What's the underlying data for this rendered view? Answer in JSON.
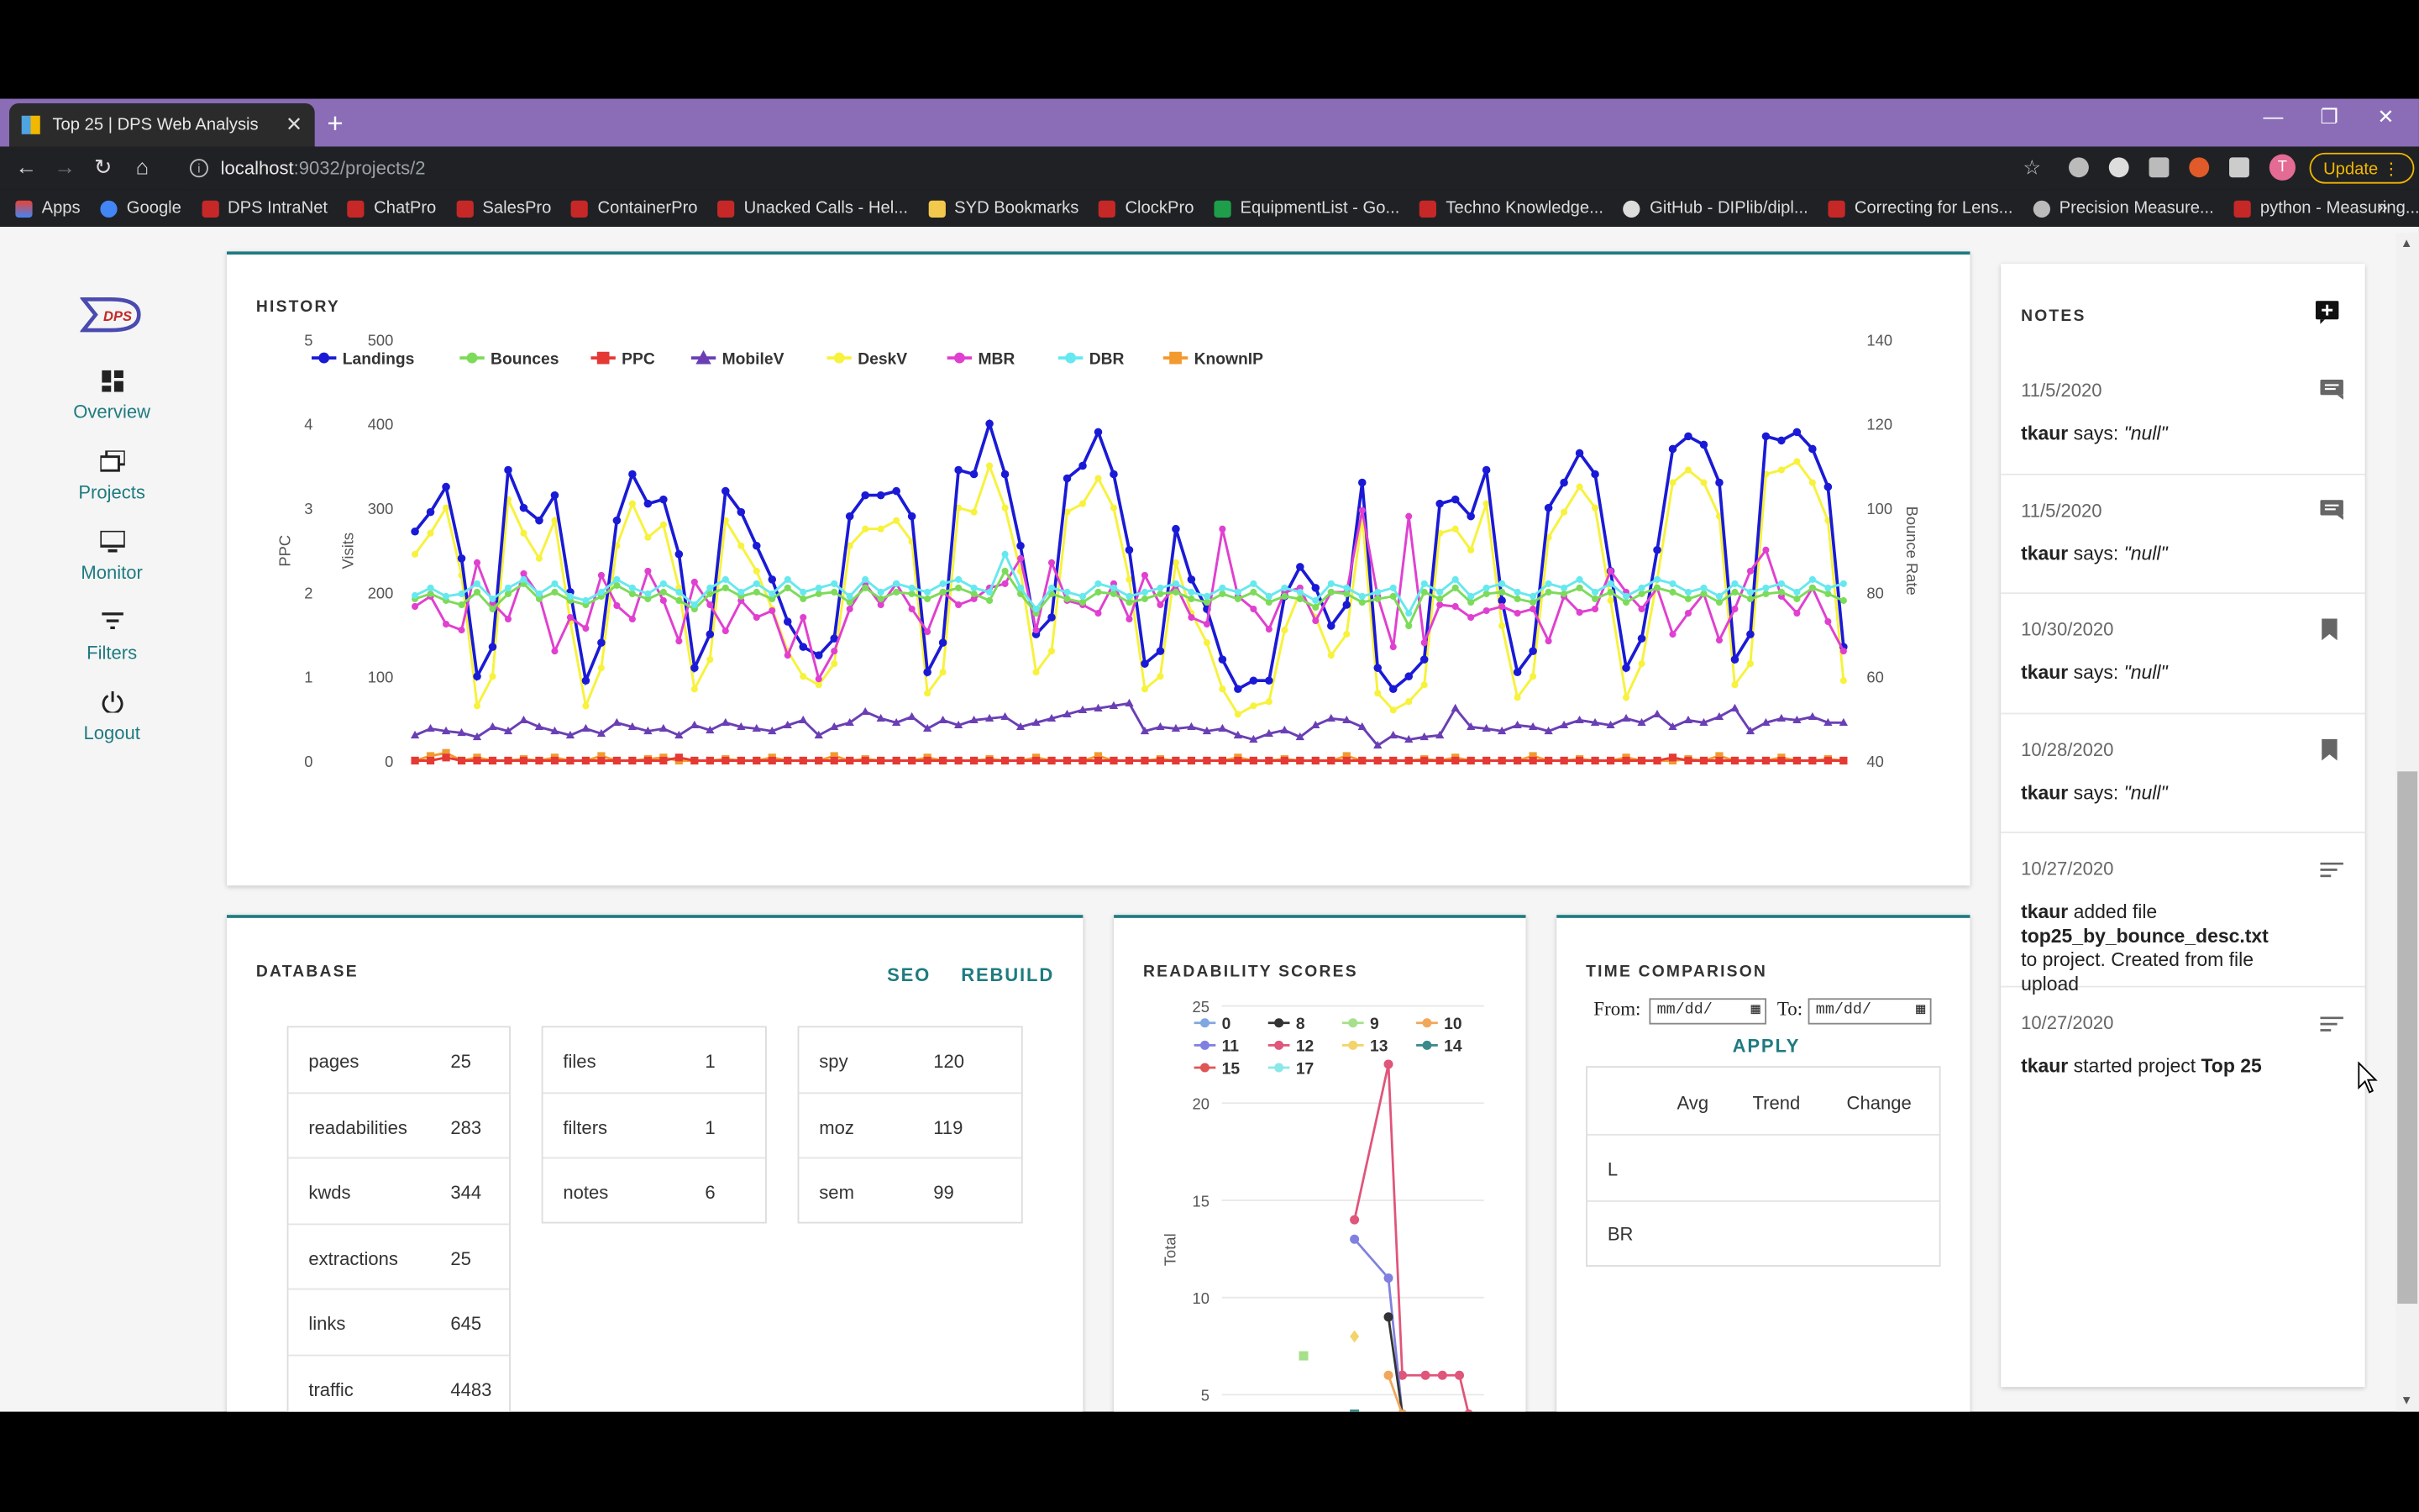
{
  "browser": {
    "tab_title": "Top 25 | DPS Web Analysis",
    "url_host": "localhost",
    "url_path": ":9032/projects/2",
    "update_label": "Update",
    "avatar_letter": "T",
    "bookmarks": [
      "Apps",
      "Google",
      "DPS IntraNet",
      "ChatPro",
      "SalesPro",
      "ContainerPro",
      "Unacked Calls - Hel...",
      "SYD Bookmarks",
      "ClockPro",
      "EquipmentList - Go...",
      "Techno Knowledge...",
      "GitHub - DIPlib/dipl...",
      "Correcting for Lens...",
      "Precision Measure...",
      "python - Measuring..."
    ],
    "bookmarks_more": "»"
  },
  "sidebar": {
    "logo": "DPS",
    "items": [
      {
        "label": "Overview",
        "icon": "dashboard-icon"
      },
      {
        "label": "Projects",
        "icon": "projects-icon"
      },
      {
        "label": "Monitor",
        "icon": "monitor-icon"
      },
      {
        "label": "Filters",
        "icon": "filter-icon"
      },
      {
        "label": "Logout",
        "icon": "power-icon"
      }
    ]
  },
  "history": {
    "title": "HISTORY"
  },
  "chart_data": {
    "type": "line",
    "title": "HISTORY",
    "legend": [
      "Landings",
      "Bounces",
      "PPC",
      "MobileV",
      "DeskV",
      "MBR",
      "DBR",
      "KnownIP"
    ],
    "colors": {
      "Landings": "#1a1ad6",
      "Bounces": "#7ddb5a",
      "PPC": "#e53935",
      "MobileV": "#6a3fb5",
      "DeskV": "#f7f23c",
      "MBR": "#e040d0",
      "DBR": "#66e8ef",
      "KnownIP": "#f29a2e"
    },
    "y_left1": {
      "label": "PPC",
      "ticks": [
        "0",
        "1",
        "2",
        "3",
        "4",
        "5"
      ]
    },
    "y_left2": {
      "label": "Visits",
      "ticks": [
        "0",
        "100",
        "200",
        "300",
        "400",
        "500"
      ],
      "range": [
        0,
        500
      ]
    },
    "y_right": {
      "label": "Bounce Rate",
      "ticks": [
        "40",
        "60",
        "80",
        "100",
        "120",
        "140"
      ],
      "range": [
        40,
        140
      ]
    },
    "series": [
      {
        "name": "Landings",
        "values": [
          272,
          295,
          325,
          240,
          100,
          135,
          345,
          300,
          285,
          315,
          200,
          95,
          140,
          285,
          340,
          305,
          310,
          245,
          110,
          150,
          320,
          295,
          255,
          215,
          165,
          135,
          125,
          145,
          290,
          315,
          315,
          320,
          290,
          105,
          140,
          345,
          340,
          400,
          340,
          255,
          150,
          170,
          335,
          350,
          390,
          340,
          250,
          115,
          130,
          275,
          215,
          180,
          120,
          85,
          95,
          95,
          195,
          230,
          205,
          160,
          185,
          330,
          110,
          85,
          100,
          120,
          305,
          310,
          290,
          345,
          190,
          105,
          130,
          300,
          330,
          365,
          340,
          225,
          110,
          145,
          250,
          370,
          385,
          375,
          330,
          120,
          150,
          385,
          380,
          390,
          370,
          325,
          135
        ]
      },
      {
        "name": "DeskV",
        "values": [
          245,
          270,
          300,
          220,
          65,
          100,
          310,
          270,
          240,
          285,
          165,
          65,
          110,
          255,
          305,
          265,
          280,
          205,
          85,
          120,
          285,
          255,
          225,
          180,
          130,
          100,
          90,
          115,
          255,
          275,
          275,
          285,
          260,
          80,
          105,
          300,
          295,
          350,
          300,
          225,
          105,
          130,
          295,
          305,
          335,
          300,
          215,
          85,
          100,
          235,
          175,
          140,
          85,
          55,
          65,
          70,
          155,
          200,
          170,
          125,
          150,
          290,
          80,
          60,
          70,
          90,
          270,
          275,
          250,
          305,
          160,
          75,
          100,
          265,
          295,
          325,
          300,
          190,
          75,
          115,
          215,
          330,
          345,
          330,
          290,
          90,
          115,
          340,
          345,
          355,
          330,
          285,
          95
        ]
      },
      {
        "name": "MBR",
        "values": [
          183,
          195,
          162,
          155,
          235,
          187,
          168,
          222,
          196,
          130,
          170,
          157,
          220,
          184,
          168,
          225,
          190,
          142,
          212,
          185,
          154,
          190,
          170,
          178,
          125,
          170,
          97,
          130,
          180,
          210,
          185,
          210,
          180,
          153,
          200,
          185,
          192,
          205,
          210,
          240,
          155,
          235,
          190,
          185,
          175,
          210,
          168,
          220,
          185,
          208,
          170,
          162,
          275,
          195,
          180,
          156,
          200,
          205,
          166,
          200,
          200,
          297,
          195,
          135,
          290,
          140,
          185,
          183,
          170,
          178,
          183,
          175,
          180,
          142,
          195,
          176,
          180,
          225,
          200,
          180,
          205,
          150,
          175,
          198,
          143,
          180,
          225,
          250,
          195,
          175,
          205,
          165,
          130
        ]
      },
      {
        "name": "DBR",
        "values": [
          196,
          205,
          195,
          198,
          210,
          192,
          205,
          215,
          198,
          210,
          195,
          190,
          200,
          215,
          205,
          198,
          210,
          200,
          185,
          205,
          215,
          200,
          210,
          198,
          215,
          200,
          205,
          210,
          195,
          215,
          200,
          210,
          205,
          200,
          210,
          215,
          205,
          200,
          245,
          205,
          180,
          205,
          200,
          195,
          210,
          205,
          195,
          200,
          205,
          210,
          200,
          195,
          205,
          200,
          210,
          195,
          205,
          200,
          190,
          210,
          205,
          195,
          200,
          205,
          175,
          210,
          200,
          215,
          195,
          205,
          210,
          200,
          195,
          210,
          205,
          215,
          200,
          210,
          195,
          205,
          215,
          210,
          200,
          205,
          195,
          210,
          200,
          205,
          210,
          200,
          215,
          205,
          210
        ]
      },
      {
        "name": "Bounces",
        "values": [
          192,
          198,
          190,
          185,
          200,
          180,
          198,
          210,
          192,
          200,
          190,
          185,
          195,
          208,
          198,
          192,
          200,
          190,
          180,
          198,
          205,
          195,
          200,
          192,
          205,
          192,
          198,
          200,
          188,
          205,
          192,
          200,
          198,
          192,
          200,
          205,
          198,
          190,
          225,
          198,
          175,
          198,
          192,
          188,
          200,
          198,
          188,
          192,
          198,
          200,
          192,
          188,
          198,
          192,
          200,
          188,
          195,
          192,
          182,
          200,
          198,
          188,
          192,
          195,
          160,
          200,
          192,
          205,
          188,
          198,
          200,
          192,
          188,
          200,
          198,
          205,
          192,
          200,
          188,
          198,
          205,
          200,
          192,
          198,
          188,
          200,
          192,
          198,
          200,
          192,
          205,
          198,
          190
        ]
      },
      {
        "name": "MobileV",
        "values": [
          30,
          38,
          35,
          33,
          28,
          40,
          35,
          48,
          40,
          35,
          30,
          38,
          32,
          45,
          40,
          35,
          38,
          30,
          42,
          36,
          45,
          40,
          38,
          35,
          42,
          48,
          30,
          40,
          45,
          58,
          50,
          45,
          52,
          38,
          48,
          42,
          48,
          50,
          52,
          40,
          45,
          50,
          55,
          60,
          62,
          65,
          68,
          35,
          40,
          38,
          40,
          35,
          38,
          30,
          25,
          32,
          36,
          28,
          42,
          50,
          48,
          40,
          18,
          30,
          25,
          28,
          30,
          62,
          40,
          38,
          35,
          42,
          40,
          35,
          42,
          48,
          45,
          42,
          50,
          45,
          55,
          40,
          48,
          45,
          52,
          62,
          35,
          45,
          50,
          48,
          52,
          45,
          45
        ]
      },
      {
        "name": "KnownIP",
        "values": [
          0,
          3,
          5,
          0,
          2,
          0,
          0,
          1,
          0,
          2,
          0,
          0,
          3,
          0,
          0,
          1,
          2,
          0,
          0,
          0,
          1,
          0,
          0,
          2,
          0,
          0,
          0,
          3,
          0,
          1,
          0,
          0,
          0,
          2,
          0,
          0,
          0,
          1,
          0,
          0,
          2,
          0,
          0,
          0,
          3,
          0,
          0,
          0,
          1,
          0,
          0,
          0,
          0,
          2,
          0,
          0,
          1,
          0,
          0,
          0,
          3,
          0,
          0,
          0,
          0,
          1,
          0,
          2,
          0,
          0,
          0,
          0,
          3,
          0,
          0,
          1,
          0,
          0,
          2,
          0,
          0,
          0,
          1,
          0,
          3,
          0,
          0,
          0,
          2,
          0,
          0,
          1,
          0
        ]
      },
      {
        "name": "PPC",
        "values": [
          0,
          0,
          2,
          0,
          0,
          0,
          0,
          0,
          0,
          0,
          0,
          0,
          0,
          0,
          0,
          0,
          0,
          2,
          0,
          0,
          0,
          0,
          0,
          0,
          0,
          0,
          0,
          0,
          0,
          0,
          0,
          0,
          0,
          0,
          0,
          0,
          0,
          0,
          0,
          0,
          0,
          0,
          0,
          0,
          0,
          0,
          0,
          0,
          0,
          0,
          0,
          0,
          0,
          0,
          0,
          0,
          0,
          0,
          0,
          0,
          0,
          0,
          0,
          0,
          0,
          0,
          0,
          0,
          0,
          0,
          0,
          0,
          0,
          0,
          0,
          0,
          0,
          0,
          0,
          0,
          0,
          2,
          0,
          0,
          0,
          0,
          0,
          0,
          0,
          0,
          0,
          0,
          0
        ]
      }
    ]
  },
  "database": {
    "title": "DATABASE",
    "seo": "SEO",
    "rebuild": "REBUILD",
    "col1": [
      {
        "k": "pages",
        "v": "25"
      },
      {
        "k": "readabilities",
        "v": "283"
      },
      {
        "k": "kwds",
        "v": "344"
      },
      {
        "k": "extractions",
        "v": "25"
      },
      {
        "k": "links",
        "v": "645"
      },
      {
        "k": "traffic",
        "v": "4483"
      }
    ],
    "col2": [
      {
        "k": "files",
        "v": "1"
      },
      {
        "k": "filters",
        "v": "1"
      },
      {
        "k": "notes",
        "v": "6"
      }
    ],
    "col3": [
      {
        "k": "spy",
        "v": "120"
      },
      {
        "k": "moz",
        "v": "119"
      },
      {
        "k": "sem",
        "v": "99"
      }
    ]
  },
  "readability": {
    "title": "READABILITY SCORES",
    "ylabel": "Total",
    "ticks": [
      "5",
      "10",
      "15",
      "20",
      "25"
    ],
    "legend": [
      {
        "n": "0",
        "c": "#7fa7e0"
      },
      {
        "n": "8",
        "c": "#333333"
      },
      {
        "n": "9",
        "c": "#a6e08a"
      },
      {
        "n": "10",
        "c": "#f2a65a"
      },
      {
        "n": "11",
        "c": "#8080e0"
      },
      {
        "n": "12",
        "c": "#e0557a"
      },
      {
        "n": "13",
        "c": "#f2d46a"
      },
      {
        "n": "14",
        "c": "#3a8a8a"
      },
      {
        "n": "15",
        "c": "#e05555"
      },
      {
        "n": "17",
        "c": "#8ae8e8"
      }
    ]
  },
  "timecomp": {
    "title": "TIME COMPARISON",
    "from": "From:",
    "to": "To:",
    "date_placeholder": "mm/dd/",
    "apply": "APPLY",
    "headers": [
      "Avg",
      "Trend",
      "Change"
    ],
    "rows": [
      "L",
      "BR"
    ]
  },
  "notes": {
    "title": "NOTES",
    "items": [
      {
        "date": "11/5/2020",
        "icon": "comment-icon",
        "user": "tkaur",
        "text": " says: ",
        "quote": "\"null\""
      },
      {
        "date": "11/5/2020",
        "icon": "comment-icon",
        "user": "tkaur",
        "text": " says: ",
        "quote": "\"null\""
      },
      {
        "date": "10/30/2020",
        "icon": "bookmark-icon",
        "user": "tkaur",
        "text": " says: ",
        "quote": "\"null\""
      },
      {
        "date": "10/28/2020",
        "icon": "bookmark-icon",
        "user": "tkaur",
        "text": " says: ",
        "quote": "\"null\""
      },
      {
        "date": "10/27/2020",
        "icon": "notes-icon",
        "user": "tkaur",
        "text": " added file ",
        "file": "top25_by_bounce_desc.txt",
        "text2": " to project. Created from file upload"
      },
      {
        "date": "10/27/2020",
        "icon": "notes-icon",
        "user": "tkaur",
        "text": " started project ",
        "file": "Top 25"
      }
    ]
  }
}
